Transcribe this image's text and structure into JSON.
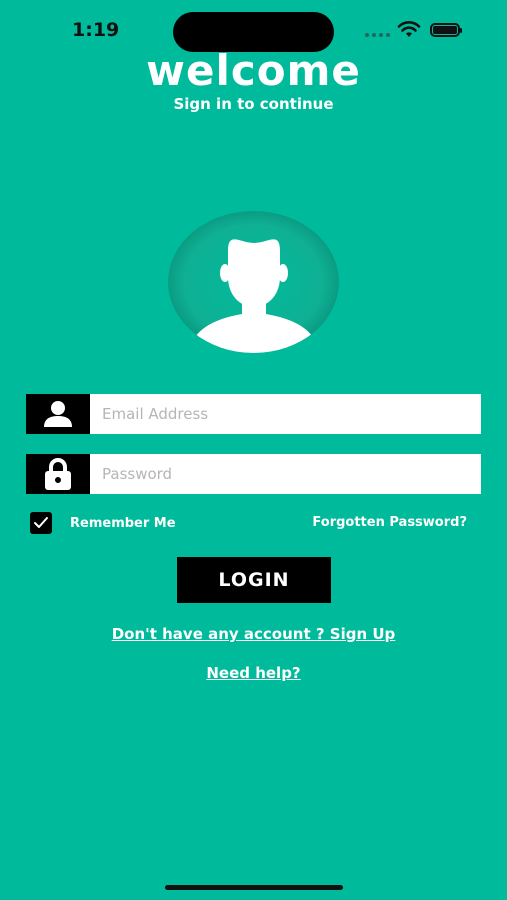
{
  "status_bar": {
    "time": "1:19"
  },
  "header": {
    "title": "welcome",
    "subtitle": "Sign in to continue"
  },
  "form": {
    "email_placeholder": "Email Address",
    "email_value": "",
    "password_placeholder": "Password",
    "password_value": "",
    "remember_label": "Remember Me",
    "remember_checked": true,
    "forgot_label": "Forgotten Password?",
    "login_label": "LOGIN"
  },
  "links": {
    "signup": "Don't have any account ? Sign Up",
    "help": "Need help?"
  },
  "icons": {
    "avatar": "user-avatar-icon",
    "email": "user-icon",
    "password": "lock-icon",
    "checkbox": "checkmark-icon"
  },
  "colors": {
    "background": "#00BB9B",
    "avatar_circle": "#10A88E",
    "button": "#000000"
  }
}
